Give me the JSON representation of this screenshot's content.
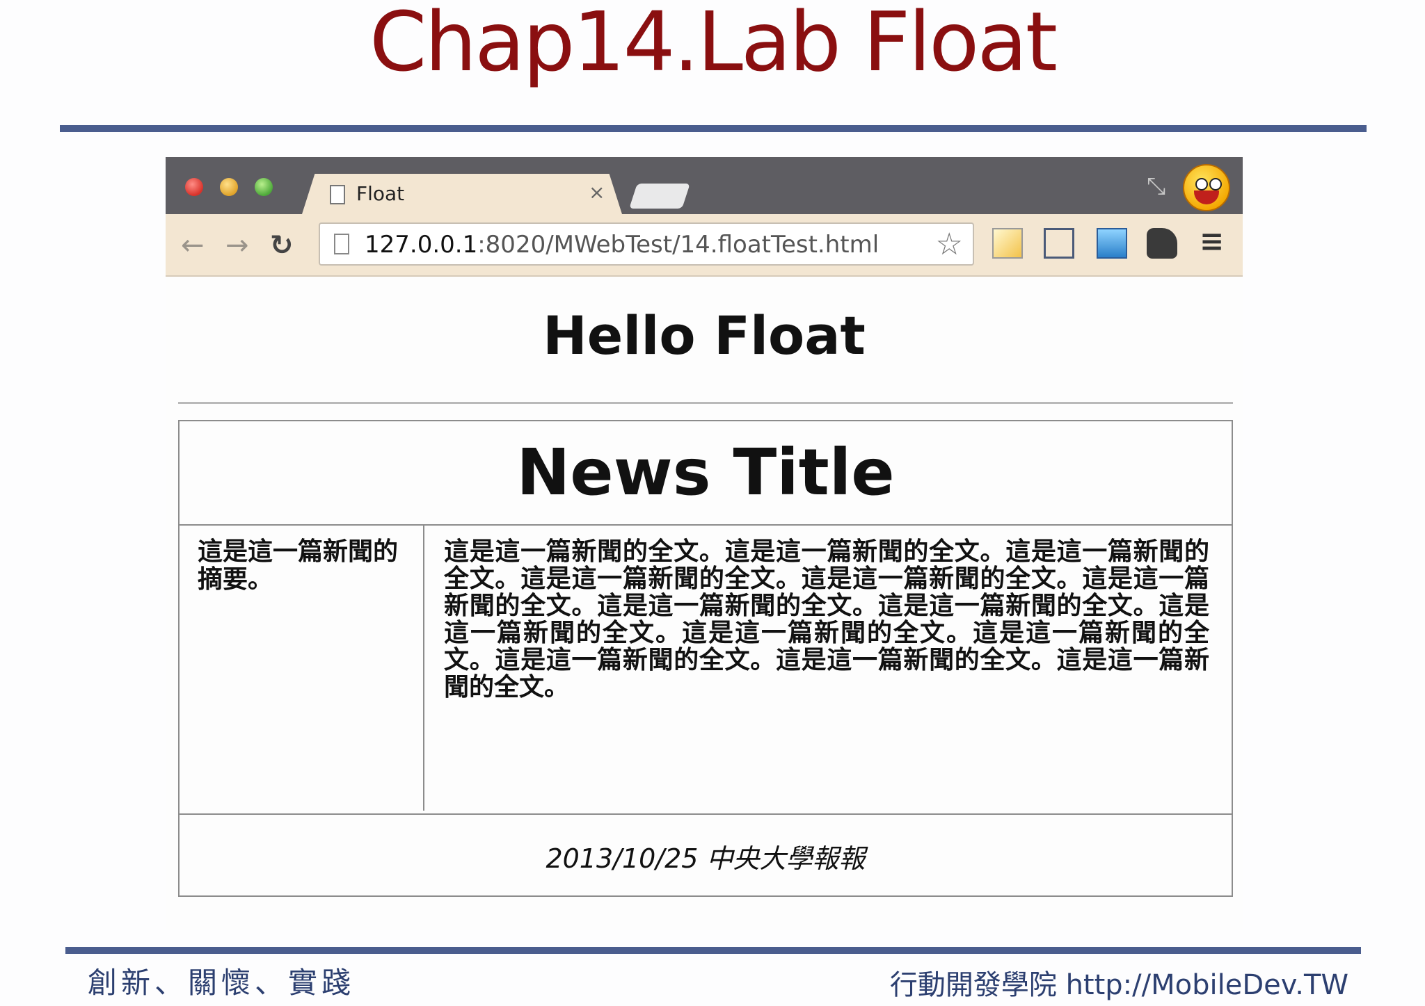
{
  "slide": {
    "title": "Chap14.Lab Float",
    "footer_left": "創新、關懷、實踐",
    "footer_right": "行動開發學院 http://MobileDev.TW"
  },
  "browser": {
    "tab_title": "Float",
    "tab_close": "×",
    "url_host": "127.0.0.1",
    "url_path": ":8020/MWebTest/14.floatTest.html",
    "icons": [
      "close-window-icon",
      "minimize-window-icon",
      "zoom-window-icon",
      "page-icon",
      "back-arrow-icon",
      "forward-arrow-icon",
      "reload-icon",
      "star-icon",
      "edit-extension-icon",
      "screen-capture-icon",
      "gallery-icon",
      "evernote-icon",
      "menu-icon",
      "restore-icon",
      "smiley-avatar-icon"
    ],
    "colors": {
      "chrome_dark": "#5e5d62",
      "chrome_light": "#f3e6d2",
      "title_red": "#8a0f10",
      "rule_blue": "#4a5d8e"
    }
  },
  "page": {
    "heading": "Hello Float",
    "news_title": "News Title",
    "summary": "這是這一篇新聞的摘要。",
    "content": "這是這一篇新聞的全文。這是這一篇新聞的全文。這是這一篇新聞的全文。這是這一篇新聞的全文。這是這一篇新聞的全文。這是這一篇新聞的全文。這是這一篇新聞的全文。這是這一篇新聞的全文。這是這一篇新聞的全文。這是這一篇新聞的全文。這是這一篇新聞的全文。這是這一篇新聞的全文。這是這一篇新聞的全文。這是這一篇新聞的全文。",
    "footer": "2013/10/25 中央大學報報"
  }
}
